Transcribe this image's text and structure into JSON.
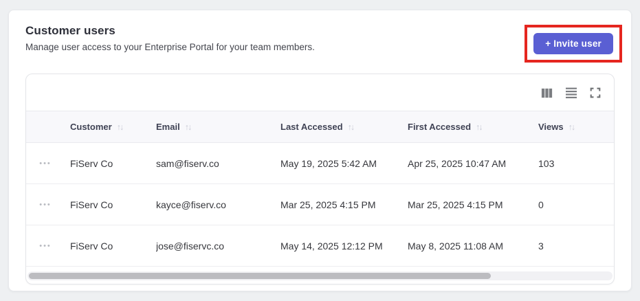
{
  "colors": {
    "accent": "#5a5fd3",
    "highlight": "#e5261f"
  },
  "header": {
    "title": "Customer users",
    "subtitle": "Manage user access to your Enterprise Portal for your team members.",
    "invite_button_label": "+ Invite user"
  },
  "toolbar": {
    "icons": [
      "columns-icon",
      "density-icon",
      "fullscreen-icon"
    ]
  },
  "icons": {
    "sort": "↑↓",
    "row_menu": "•••"
  },
  "table": {
    "columns": [
      {
        "label": "Customer"
      },
      {
        "label": "Email"
      },
      {
        "label": "Last Accessed"
      },
      {
        "label": "First Accessed"
      },
      {
        "label": "Views"
      }
    ],
    "rows": [
      {
        "customer": "FiServ Co",
        "email": "sam@fiserv.co",
        "last_accessed": "May 19, 2025 5:42 AM",
        "first_accessed": "Apr 25, 2025 10:47 AM",
        "views": "103"
      },
      {
        "customer": "FiServ Co",
        "email": "kayce@fiserv.co",
        "last_accessed": "Mar 25, 2025 4:15 PM",
        "first_accessed": "Mar 25, 2025 4:15 PM",
        "views": "0"
      },
      {
        "customer": "FiServ Co",
        "email": "jose@fiservc.co",
        "last_accessed": "May 14, 2025 12:12 PM",
        "first_accessed": "May 8, 2025 11:08 AM",
        "views": "3"
      }
    ]
  },
  "scrollbar": {
    "thumb_width_percent": 79
  }
}
